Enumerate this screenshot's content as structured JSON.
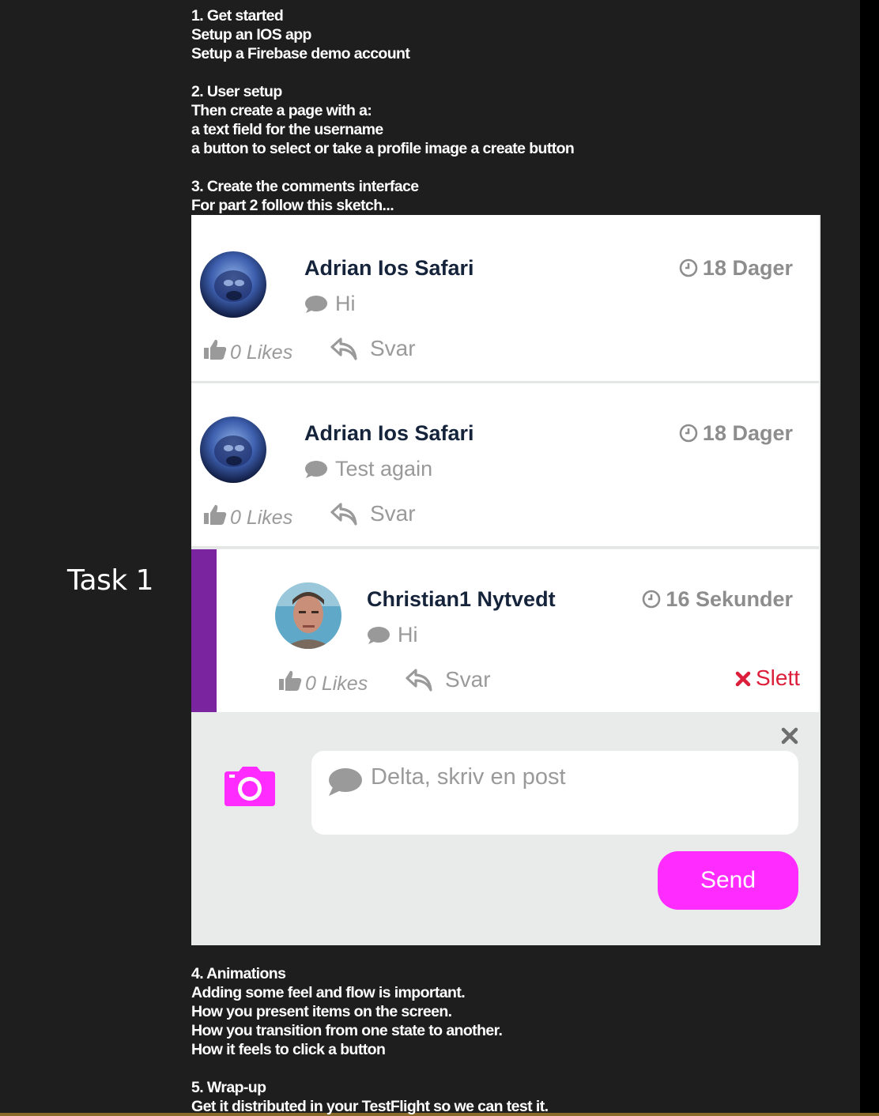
{
  "task_label": "Task 1",
  "notes_top": [
    "1. Get started",
    "Setup an IOS app",
    "Setup a Firebase demo account",
    "",
    "2. User setup",
    "Then create a page with a:",
    "a text field for the username",
    "a button to select or take a profile image a create button",
    "",
    "3. Create the comments interface",
    "For part 2 follow this sketch..."
  ],
  "notes_bottom": [
    "4. Animations",
    "Adding some feel and flow is important.",
    "How you present items on the screen.",
    "How you transition from one state to another.",
    "How it feels to click a button",
    "",
    "5. Wrap-up",
    "Get it distributed in your TestFlight so we can test it."
  ],
  "comments": [
    {
      "author": "Adrian Ios Safari",
      "time": "18 Dager",
      "text": "Hi",
      "likes": "0 Likes",
      "reply": "Svar"
    },
    {
      "author": "Adrian Ios Safari",
      "time": "18 Dager",
      "text": "Test again",
      "likes": "0 Likes",
      "reply": "Svar"
    },
    {
      "author": "Christian1 Nytvedt",
      "time": "16 Sekunder",
      "text": "Hi",
      "likes": "0 Likes",
      "reply": "Svar",
      "delete": "Slett"
    }
  ],
  "composer": {
    "placeholder": "Delta, skriv en post",
    "send_label": "Send"
  },
  "colors": {
    "accent": "#ff2bff",
    "reply_bar": "#7a24a0",
    "delete": "#dc1e3a",
    "name": "#15233b"
  },
  "icons": [
    "clock-icon",
    "speech-bubble-icon",
    "thumbs-up-icon",
    "reply-arrow-icon",
    "close-icon",
    "camera-icon"
  ]
}
